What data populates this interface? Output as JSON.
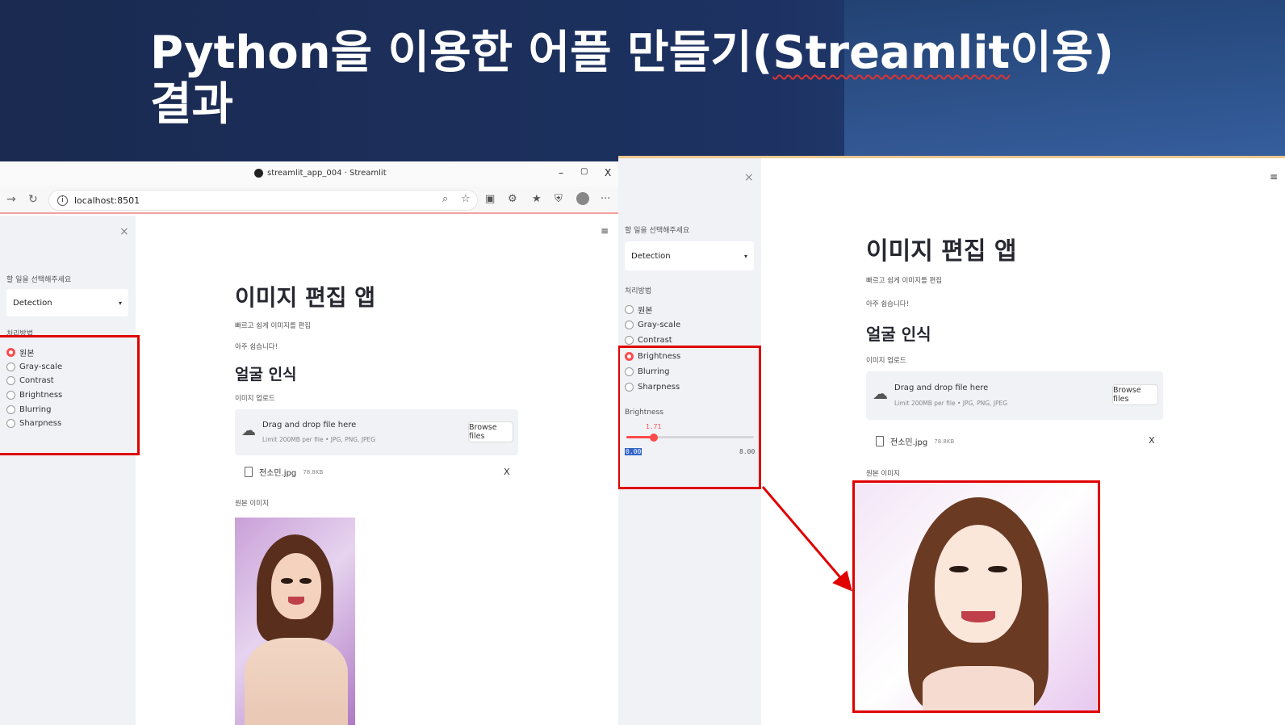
{
  "slide": {
    "title_line1_pre": "Python을 이용한 어플 만들기(",
    "title_line1_word": "Streamlit",
    "title_line1_post": "이용)",
    "title_line2": "결과"
  },
  "browser": {
    "tab_title": "streamlit_app_004 · Streamlit",
    "url": "localhost:8501",
    "minimize": "–",
    "restore": "▢",
    "close": "X"
  },
  "app": {
    "sidebar": {
      "close": "×",
      "select_label": "할 일을 선택해주세요",
      "select_value": "Detection",
      "radio_label": "처리방법",
      "options": [
        "원본",
        "Gray-scale",
        "Contrast",
        "Brightness",
        "Blurring",
        "Sharpness"
      ]
    },
    "menu": "≡",
    "title": "이미지 편집 앱",
    "caption1": "빠르고 쉽게 이미지를 편집",
    "caption2": "아주 쉽습니다!",
    "subheader": "얼굴 인식",
    "upload_label": "이미지 업로드",
    "uploader": {
      "drag_text": "Drag and drop file here",
      "limit_text": "Limit 200MB per file • JPG, PNG, JPEG",
      "browse": "Browse files"
    },
    "file": {
      "name": "전소민.jpg",
      "size": "78.8KB",
      "remove": "X"
    },
    "image_caption": "원본 이미지"
  },
  "left_state": {
    "selected_option": "원본"
  },
  "right_state": {
    "selected_option": "Brightness",
    "slider": {
      "label": "Brightness",
      "value": "1.71",
      "min": "0.00",
      "max": "8.00",
      "fraction": 0.214
    }
  },
  "colors": {
    "accent": "#ff4b4b",
    "highlight_box": "#e00000",
    "slide_bg": "#1d3262"
  }
}
